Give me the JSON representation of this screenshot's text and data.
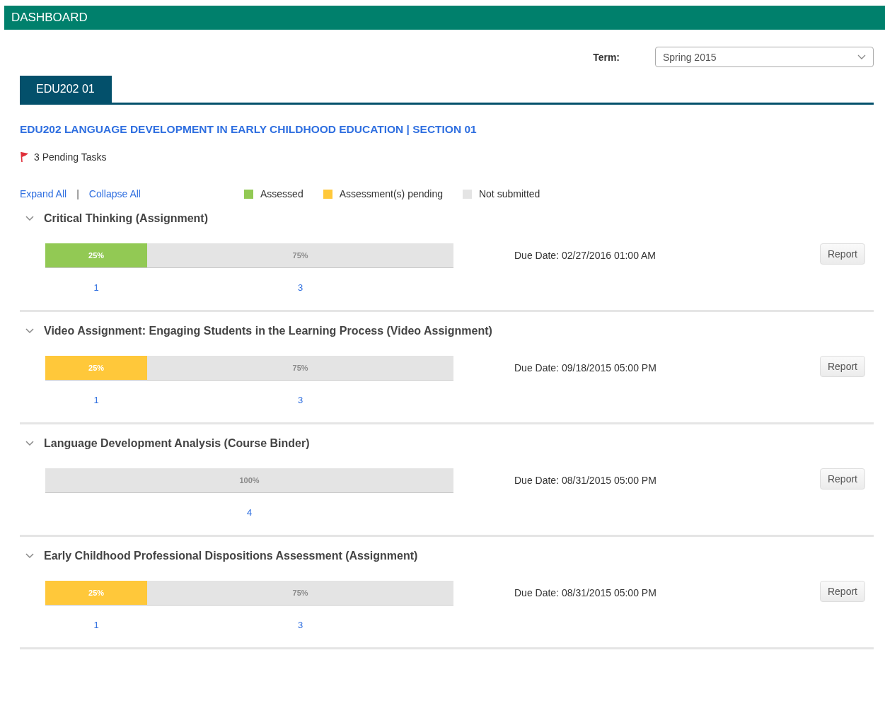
{
  "header": {
    "title": "DASHBOARD"
  },
  "term": {
    "label": "Term:",
    "value": "Spring 2015"
  },
  "tabs": [
    {
      "label": "EDU202 01",
      "selected": true
    }
  ],
  "course_title": "EDU202 LANGUAGE DEVELOPMENT IN EARLY CHILDHOOD EDUCATION | SECTION 01",
  "pending": "3 Pending Tasks",
  "links": [
    "Expand All",
    "Collapse All"
  ],
  "separator": "|",
  "legend": [
    {
      "label": "Assessed",
      "color": "#92c954"
    },
    {
      "label": "Assessment(s) pending",
      "color": "#ffc83a"
    },
    {
      "label": "Not submitted",
      "color": "#e4e4e4"
    }
  ],
  "assignments": [
    {
      "title": "Critical Thinking (Assignment)",
      "expanded": true,
      "due": "Due Date: 02/27/2016 01:00 AM",
      "button": "Report",
      "segments": [
        {
          "kind": "assessed",
          "level": 0.25,
          "label": "25%",
          "count": "1"
        },
        {
          "kind": "not_submitted",
          "level": 0.75,
          "label": "75%",
          "count": "3"
        }
      ]
    },
    {
      "title": "Video Assignment: Engaging Students in the Learning Process (Video Assignment)",
      "expanded": true,
      "due": "Due Date: 09/18/2015 05:00 PM",
      "button": "Report",
      "segments": [
        {
          "kind": "pending",
          "level": 0.25,
          "label": "25%",
          "count": "1"
        },
        {
          "kind": "not_submitted",
          "level": 0.75,
          "label": "75%",
          "count": "3"
        }
      ]
    },
    {
      "title": "Language Development Analysis (Course Binder)",
      "expanded": true,
      "due": "Due Date: 08/31/2015 05:00 PM",
      "button": "Report",
      "segments": [
        {
          "kind": "not_submitted",
          "level": 1,
          "label": "100%",
          "count": "4"
        }
      ]
    },
    {
      "title": "Early Childhood Professional Dispositions Assessment (Assignment)",
      "expanded": true,
      "due": "Due Date: 08/31/2015 05:00 PM",
      "button": "Report",
      "segments": [
        {
          "kind": "pending",
          "level": 0.25,
          "label": "25%",
          "count": "1"
        },
        {
          "kind": "not_submitted",
          "level": 0.75,
          "label": "75%",
          "count": "3"
        }
      ]
    }
  ]
}
